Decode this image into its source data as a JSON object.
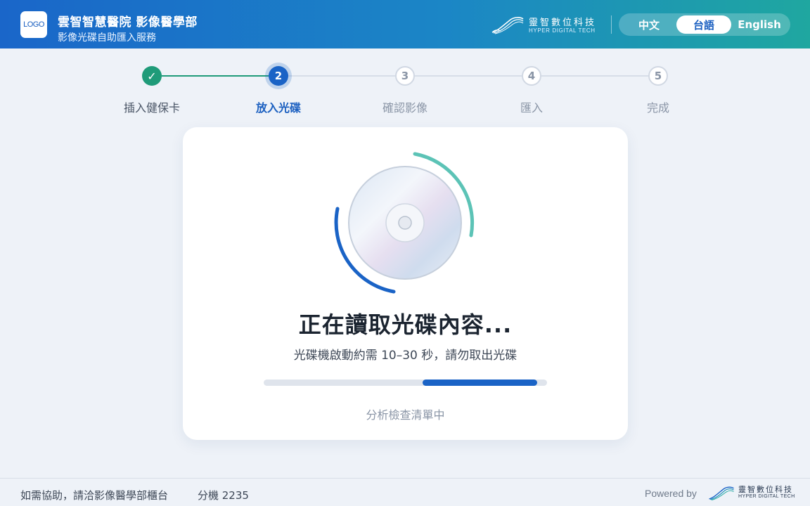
{
  "header": {
    "logo_text": "LOGO",
    "title": "雲智智慧醫院 影像醫學部",
    "subtitle": "影像光碟自助匯入服務",
    "brand_cn": "靈智數位科技",
    "brand_en": "HYPER DIGITAL TECH",
    "languages": [
      {
        "label": "中文",
        "active": false
      },
      {
        "label": "台語",
        "active": true
      },
      {
        "label": "English",
        "active": false
      }
    ]
  },
  "stepper": {
    "steps": [
      {
        "number": "✓",
        "label": "插入健保卡",
        "state": "done"
      },
      {
        "number": "2",
        "label": "放入光碟",
        "state": "current"
      },
      {
        "number": "3",
        "label": "確認影像",
        "state": "pending"
      },
      {
        "number": "4",
        "label": "匯入",
        "state": "pending"
      },
      {
        "number": "5",
        "label": "完成",
        "state": "pending"
      }
    ]
  },
  "card": {
    "title": "正在讀取光碟內容...",
    "subtitle": "光碟機啟動約需 10–30 秒，請勿取出光碟",
    "progress": {
      "start_fraction": 0.56,
      "end_fraction": 0.965
    },
    "status": "分析檢查清單中"
  },
  "footer": {
    "help": "如需協助，請洽影像醫學部櫃台",
    "extension": "分機 2235",
    "powered_by": "Powered by",
    "brand_cn": "靈智數位科技",
    "brand_en": "HYPER DIGITAL TECH"
  },
  "colors": {
    "primary": "#1a63c6",
    "success": "#1f9b79",
    "teal": "#5cc3b6"
  }
}
